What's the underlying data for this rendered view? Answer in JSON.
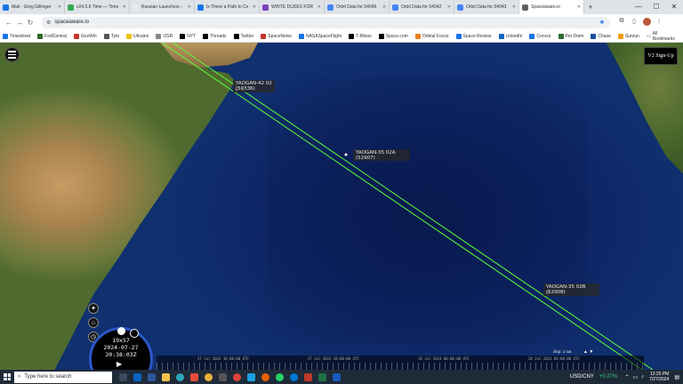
{
  "browser": {
    "tabs": [
      {
        "label": "Mail - Greg Gillinger",
        "color": "#1a73e8",
        "active": false
      },
      {
        "label": "v24.5.6 Time — Time",
        "color": "#34a853",
        "active": false
      },
      {
        "label": "Russian Launchers -",
        "color": "#e8eaed",
        "active": false
      },
      {
        "label": "Is There a Path to Co",
        "color": "#1a73e8",
        "active": false
      },
      {
        "label": "WHITE DUDES FOR",
        "color": "#7b3fbf",
        "active": false
      },
      {
        "label": "Orbit Data for 54045",
        "color": "#4285f4",
        "active": false
      },
      {
        "label": "Orbit Data for 54042",
        "color": "#4285f4",
        "active": false
      },
      {
        "label": "Orbit Data for 54043",
        "color": "#4285f4",
        "active": false
      },
      {
        "label": "Spaceaware.io",
        "color": "#5f6368",
        "active": true
      }
    ],
    "url": "spaceaware.io",
    "bookmarks": [
      {
        "label": "Timesheet",
        "color": "#1a73e8"
      },
      {
        "label": "FedCentral",
        "color": "#2d6a2d"
      },
      {
        "label": "GovWin",
        "color": "#c0392b"
      },
      {
        "label": "Tyto",
        "color": "#555"
      },
      {
        "label": "Ukraine",
        "color": "#f1c40f"
      },
      {
        "label": "IJSR",
        "color": "#888"
      },
      {
        "label": "NYT",
        "color": "#000"
      },
      {
        "label": "Threads",
        "color": "#000"
      },
      {
        "label": "Twitter",
        "color": "#000"
      },
      {
        "label": "SpaceNews",
        "color": "#c0392b"
      },
      {
        "label": "NASASpaceFlight",
        "color": "#1a73e8"
      },
      {
        "label": "T-Minus",
        "color": "#000"
      },
      {
        "label": "Space.com",
        "color": "#000"
      },
      {
        "label": "Orbital Focus",
        "color": "#e67e22"
      },
      {
        "label": "Space Review",
        "color": "#1a73e8"
      },
      {
        "label": "LinkedIn",
        "color": "#0a66c2"
      },
      {
        "label": "Concur",
        "color": "#1a73e8"
      },
      {
        "label": "Per Diem",
        "color": "#2d6a2d"
      },
      {
        "label": "Chase",
        "color": "#1a4fa0"
      },
      {
        "label": "Sunrun",
        "color": "#f39c12"
      }
    ],
    "all_bookmarks": "All Bookmarks"
  },
  "app": {
    "signup_label": "V2 Sign-Up",
    "satellites": [
      {
        "name": "YAOGAN-42 02",
        "id": "(59336)"
      },
      {
        "name": "YAOGAN-35 02A",
        "id": "(52907)"
      },
      {
        "name": "YAOGAN-35 02B",
        "id": "(52908)"
      }
    ],
    "clock": {
      "speed": "19x57",
      "date": "2024-07-27",
      "time": "20:38:03Z"
    },
    "timeline_labels": [
      "27 Jul 2024 16:00:00 UTC",
      "27 Jul 2024 20:00:00 UTC",
      "28 Jul 2024 00:00:00 UTC",
      "28 Jul 2024 04:00:00 UTC"
    ],
    "time_step": "disp: 1 sat",
    "colors": {
      "orbit": "#5bff3a",
      "dial": "#2b57c6"
    }
  },
  "taskbar": {
    "search_placeholder": "Type here to search",
    "currency": "USD/CNY",
    "currency_change": "+0.27%",
    "time": "12:25 PM",
    "date": "7/27/2024"
  }
}
